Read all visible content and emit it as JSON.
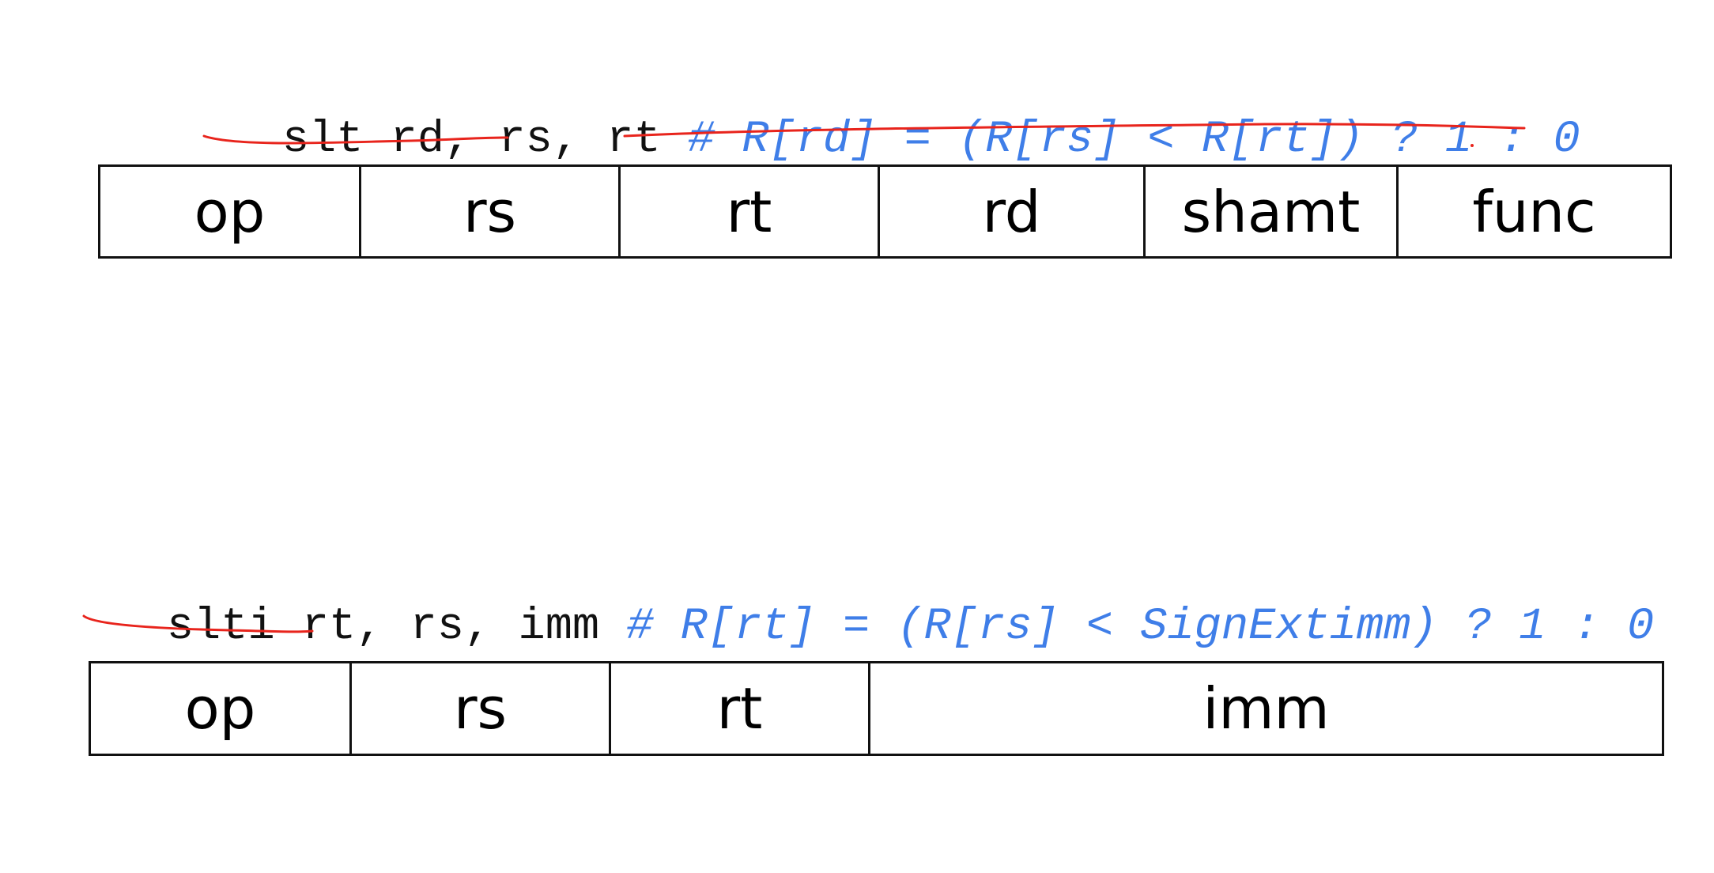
{
  "r_type": {
    "instruction": "slt rd, rs, rt",
    "comment": "# R[rd] = (R[rs] < R[rt]) ? 1 : 0",
    "fields": [
      "op",
      "rs",
      "rt",
      "rd",
      "shamt",
      "func"
    ]
  },
  "i_type": {
    "instruction": "slti rt, rs, imm",
    "comment": "# R[rt] = (R[rs] < SignExtimm) ? 1 : 0",
    "fields": [
      "op",
      "rs",
      "rt",
      "imm"
    ]
  },
  "colors": {
    "comment": "#3f7ee8",
    "annotation": "#e8241c",
    "text": "#111111"
  }
}
